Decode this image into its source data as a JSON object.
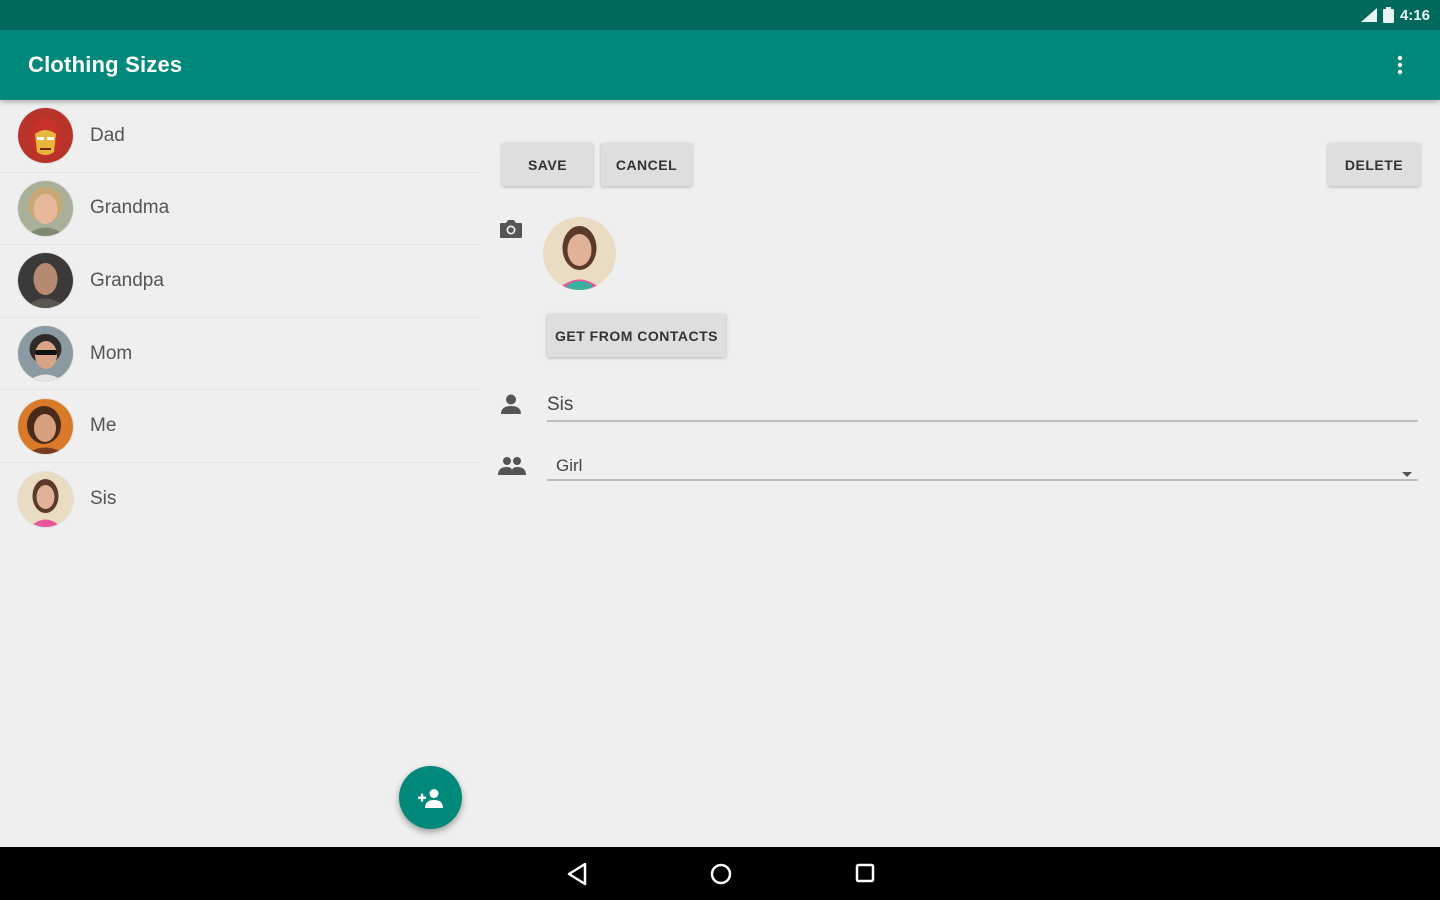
{
  "status_bar": {
    "time": "4:16"
  },
  "app_bar": {
    "title": "Clothing Sizes"
  },
  "people": [
    {
      "name": "Dad",
      "avatar": "iron-man-avatar"
    },
    {
      "name": "Grandma",
      "avatar": "grandma-avatar"
    },
    {
      "name": "Grandpa",
      "avatar": "grandpa-avatar"
    },
    {
      "name": "Mom",
      "avatar": "mom-avatar"
    },
    {
      "name": "Me",
      "avatar": "me-avatar"
    },
    {
      "name": "Sis",
      "avatar": "sis-avatar"
    }
  ],
  "detail": {
    "save_label": "SAVE",
    "cancel_label": "CANCEL",
    "delete_label": "DELETE",
    "contacts_label": "GET FROM CONTACTS",
    "name_value": "Sis",
    "group_value": "Girl"
  },
  "colors": {
    "primary": "#00897b",
    "primary_dark": "#00695c",
    "background": "#efefef"
  }
}
